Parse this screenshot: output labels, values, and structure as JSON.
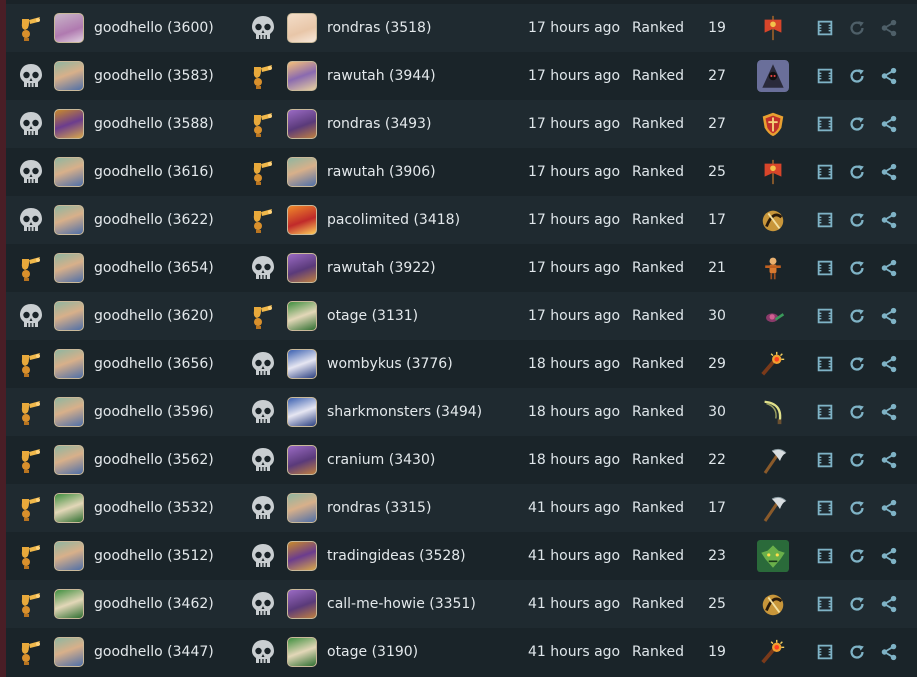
{
  "colors": {
    "bg": "#1a2328",
    "row_alt": "#1f2a30",
    "text": "#dfe6ea",
    "action": "#7fb3c6",
    "action_dim": "#4e5f68",
    "trophy": "#e8a93b",
    "skull": "#c9ced1"
  },
  "games": [
    {
      "p1_result": "win",
      "p1_avatar": "mage",
      "p1": "goodhello (3600)",
      "p2_result": "loss",
      "p2_avatar": "doll",
      "p2": "rondras (3518)",
      "time": "17 hours ago",
      "type": "Ranked",
      "turns": "19",
      "card": "banner-icon",
      "dim_replay": true
    },
    {
      "p1_result": "loss",
      "p1_avatar": "hero",
      "p1": "goodhello (3583)",
      "p2_result": "win",
      "p2_avatar": "knight",
      "p2": "rawutah (3944)",
      "time": "17 hours ago",
      "type": "Ranked",
      "turns": "27",
      "card": "hooded-icon",
      "dim_replay": false
    },
    {
      "p1_result": "loss",
      "p1_avatar": "gold",
      "p1": "goodhello (3588)",
      "p2_result": "win",
      "p2_avatar": "beast",
      "p2": "rondras (3493)",
      "time": "17 hours ago",
      "type": "Ranked",
      "turns": "27",
      "card": "shield-icon",
      "dim_replay": false
    },
    {
      "p1_result": "loss",
      "p1_avatar": "hero",
      "p1": "goodhello (3616)",
      "p2_result": "win",
      "p2_avatar": "hero",
      "p2": "rawutah (3906)",
      "time": "17 hours ago",
      "type": "Ranked",
      "turns": "25",
      "card": "banner-icon",
      "dim_replay": false
    },
    {
      "p1_result": "loss",
      "p1_avatar": "hero",
      "p1": "goodhello (3622)",
      "p2_result": "win",
      "p2_avatar": "fire",
      "p2": "pacolimited (3418)",
      "time": "17 hours ago",
      "type": "Ranked",
      "turns": "17",
      "card": "swirl-icon",
      "dim_replay": false
    },
    {
      "p1_result": "win",
      "p1_avatar": "hero",
      "p1": "goodhello (3654)",
      "p2_result": "loss",
      "p2_avatar": "beast",
      "p2": "rawutah (3922)",
      "time": "17 hours ago",
      "type": "Ranked",
      "turns": "21",
      "card": "doll-icon",
      "dim_replay": false
    },
    {
      "p1_result": "loss",
      "p1_avatar": "hero",
      "p1": "goodhello (3620)",
      "p2_result": "win",
      "p2_avatar": "elf",
      "p2": "otage (3131)",
      "time": "17 hours ago",
      "type": "Ranked",
      "turns": "30",
      "card": "snail-icon",
      "dim_replay": false
    },
    {
      "p1_result": "win",
      "p1_avatar": "hero",
      "p1": "goodhello (3656)",
      "p2_result": "loss",
      "p2_avatar": "wizard",
      "p2": "wombykus (3776)",
      "time": "18 hours ago",
      "type": "Ranked",
      "turns": "29",
      "card": "firework-icon",
      "dim_replay": false
    },
    {
      "p1_result": "win",
      "p1_avatar": "hero",
      "p1": "goodhello (3596)",
      "p2_result": "loss",
      "p2_avatar": "wizard",
      "p2": "sharkmonsters (3494)",
      "time": "18 hours ago",
      "type": "Ranked",
      "turns": "30",
      "card": "whip-icon",
      "dim_replay": false
    },
    {
      "p1_result": "win",
      "p1_avatar": "hero",
      "p1": "goodhello (3562)",
      "p2_result": "loss",
      "p2_avatar": "beast",
      "p2": "cranium (3430)",
      "time": "18 hours ago",
      "type": "Ranked",
      "turns": "22",
      "card": "axe-icon",
      "dim_replay": false
    },
    {
      "p1_result": "win",
      "p1_avatar": "elf",
      "p1": "goodhello (3532)",
      "p2_result": "loss",
      "p2_avatar": "hero",
      "p2": "rondras (3315)",
      "time": "41 hours ago",
      "type": "Ranked",
      "turns": "17",
      "card": "axe-icon",
      "dim_replay": false
    },
    {
      "p1_result": "win",
      "p1_avatar": "hero",
      "p1": "goodhello (3512)",
      "p2_result": "loss",
      "p2_avatar": "gold",
      "p2": "tradingideas (3528)",
      "time": "41 hours ago",
      "type": "Ranked",
      "turns": "23",
      "card": "goblin-icon",
      "dim_replay": false
    },
    {
      "p1_result": "win",
      "p1_avatar": "elf",
      "p1": "goodhello (3462)",
      "p2_result": "loss",
      "p2_avatar": "beast",
      "p2": "call-me-howie (3351)",
      "time": "41 hours ago",
      "type": "Ranked",
      "turns": "25",
      "card": "swirl-icon",
      "dim_replay": false
    },
    {
      "p1_result": "win",
      "p1_avatar": "hero",
      "p1": "goodhello (3447)",
      "p2_result": "loss",
      "p2_avatar": "elf",
      "p2": "otage (3190)",
      "time": "41 hours ago",
      "type": "Ranked",
      "turns": "19",
      "card": "firework-icon",
      "dim_replay": false
    }
  ]
}
